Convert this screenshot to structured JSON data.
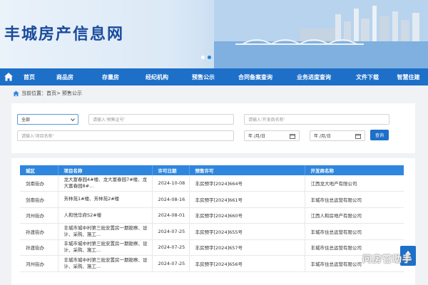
{
  "site": {
    "title": "丰城房产信息网"
  },
  "nav": {
    "items": [
      {
        "label": "首页",
        "key": "home"
      },
      {
        "label": "商品房",
        "key": "commercial"
      },
      {
        "label": "存量房",
        "key": "existing"
      },
      {
        "label": "经纪机构",
        "key": "agency"
      },
      {
        "label": "预售公示",
        "key": "presale"
      },
      {
        "label": "合同备案查询",
        "key": "contract"
      },
      {
        "label": "业务进度查询",
        "key": "progress"
      },
      {
        "label": "文件下载",
        "key": "download"
      },
      {
        "label": "智慧住建",
        "key": "smart"
      }
    ]
  },
  "breadcrumb": {
    "prefix": "当前位置：",
    "home": "首页",
    "sep": ">",
    "current": "预售公示"
  },
  "search": {
    "district_value": "全部",
    "permit_placeholder": "请输入'预售证号'",
    "developer_placeholder": "请输入'开发商名称'",
    "project_placeholder": "请输入'项目名称'",
    "date_from": "年 /月/日",
    "date_to": "年 /月/日",
    "query_label": "查询"
  },
  "table": {
    "headers": [
      "城区",
      "项目名称",
      "许可日期",
      "预售许可",
      "开发商名称"
    ],
    "rows": [
      {
        "district": "剑南街办",
        "project": "龙大富春园4#楼、龙大富春园7#楼、龙大富春园8#...",
        "date": "2024-10-08",
        "permit": "丰房预字[2024]664号",
        "developer": "江西龙大地产有限公司"
      },
      {
        "district": "剑南街办",
        "project": "芳林苑1#楼、芳林苑2#楼",
        "date": "2024-08-16",
        "permit": "丰房预字[2024]661号",
        "developer": "丰城市住总运营有限公司"
      },
      {
        "district": "河州街办",
        "project": "人和悦华府S2#楼",
        "date": "2024-08-01",
        "permit": "丰房预字[2024]660号",
        "developer": "江西人和房地产有限公司"
      },
      {
        "district": "孙渡街办",
        "project": "丰城市城中村第三批安置房一期勘察、设计、采购、施工...",
        "date": "2024-07-25",
        "permit": "丰房预字[2024]655号",
        "developer": "丰城市住总运营有限公司"
      },
      {
        "district": "孙渡街办",
        "project": "丰城市城中村第三批安置房一期勘察、设计、采购、施工...",
        "date": "2024-07-25",
        "permit": "丰房预字[2024]657号",
        "developer": "丰城市住总运营有限公司"
      },
      {
        "district": "河州街办",
        "project": "丰城市城中村第三批安置房一期勘察、设计、采购、施工...",
        "date": "2024-07-25",
        "permit": "丰房预字[2024]656号",
        "developer": "丰城市住总运营有限公司"
      }
    ]
  },
  "top_button": {
    "label": "TOP"
  },
  "watermark": {
    "text": "问房管助手"
  },
  "colors": {
    "nav": "#1e6fc8",
    "header": "#2e86de",
    "title": "#1a4b9c"
  }
}
